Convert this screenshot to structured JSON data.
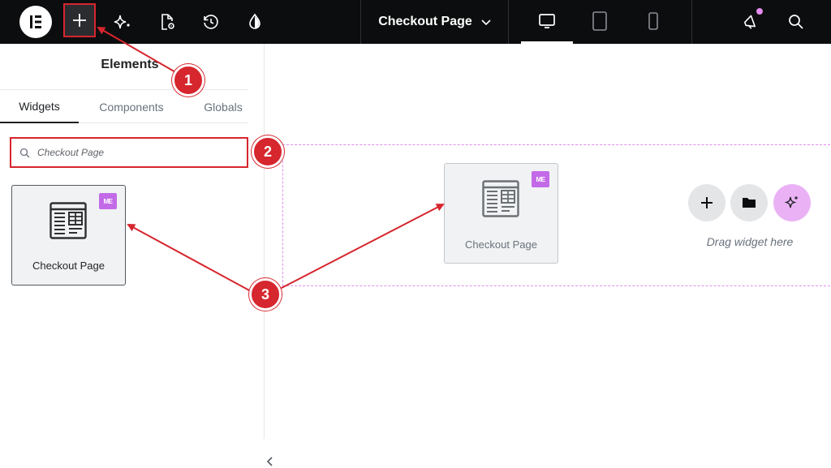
{
  "topbar": {
    "page_title": "Checkout Page",
    "icons": [
      "elementor-logo-icon",
      "add-element-icon",
      "ai-sparkle-icon",
      "page-settings-icon",
      "history-icon",
      "site-settings-icon",
      "chevron-down-icon",
      "desktop-icon",
      "tablet-icon",
      "mobile-icon",
      "whats-new-icon",
      "search-icon"
    ]
  },
  "sidebar": {
    "title": "Elements",
    "tabs": [
      {
        "label": "Widgets",
        "active": true
      },
      {
        "label": "Components",
        "active": false
      },
      {
        "label": "Globals",
        "active": false
      }
    ],
    "search": {
      "value": "Checkout Page"
    },
    "widget": {
      "label": "Checkout Page",
      "badge": "ME"
    }
  },
  "canvas": {
    "drag_widget": {
      "label": "Checkout Page",
      "badge": "ME"
    },
    "drag_hint": "Drag widget here"
  },
  "annotations": {
    "steps": [
      "1",
      "2",
      "3"
    ]
  },
  "colors": {
    "topbar_bg": "#0c0d0e",
    "annotation_red": "#d6262e",
    "pro_badge": "#c36ae8",
    "drop_zone_border": "#e38cf1",
    "ai_button": "#eab2f5"
  }
}
